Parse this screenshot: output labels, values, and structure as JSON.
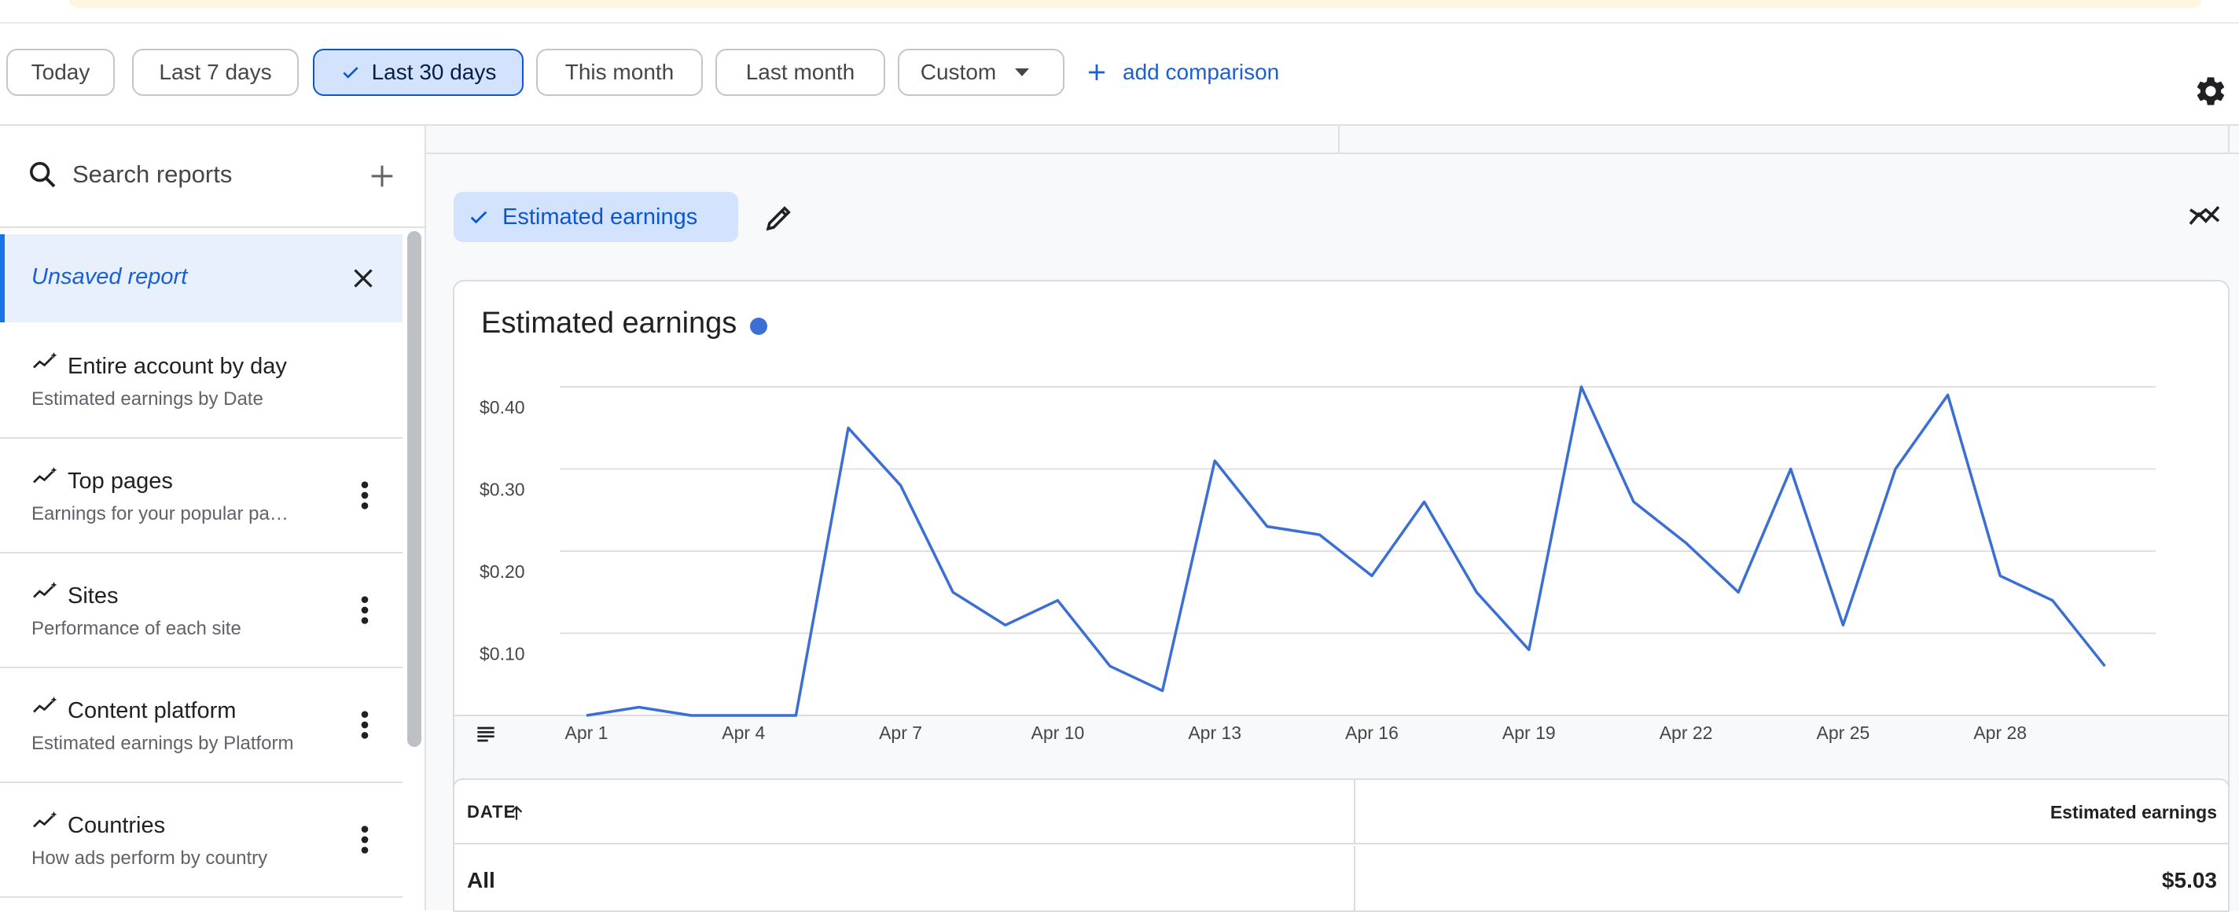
{
  "date_ranges": [
    {
      "label": "Today",
      "selected": false
    },
    {
      "label": "Last 7 days",
      "selected": false
    },
    {
      "label": "Last 30 days",
      "selected": true
    },
    {
      "label": "This month",
      "selected": false
    },
    {
      "label": "Last month",
      "selected": false
    }
  ],
  "custom_label": "Custom",
  "add_comparison_label": "add comparison",
  "search": {
    "label": "Search reports"
  },
  "unsaved_report_label": "Unsaved report",
  "reports": [
    {
      "title": "Entire account by day",
      "subtitle": "Estimated earnings by Date"
    },
    {
      "title": "Top pages",
      "subtitle": "Earnings for your popular pages"
    },
    {
      "title": "Sites",
      "subtitle": "Performance of each site"
    },
    {
      "title": "Content platform",
      "subtitle": "Estimated earnings by Platform"
    },
    {
      "title": "Countries",
      "subtitle": "How ads perform by country"
    }
  ],
  "metric_chip_label": "Estimated earnings",
  "colors": {
    "accent": "#3b6fd4",
    "chip_bg": "#d3e3fd",
    "chip_text": "#0b57d0"
  },
  "chart_data": {
    "type": "line",
    "title": "Estimated earnings",
    "x_tick_labels": [
      "Apr 1",
      "Apr 4",
      "Apr 7",
      "Apr 10",
      "Apr 13",
      "Apr 16",
      "Apr 19",
      "Apr 22",
      "Apr 25",
      "Apr 28"
    ],
    "y_tick_labels": [
      "$0.40",
      "$0.30",
      "$0.20",
      "$0.10"
    ],
    "ylim": [
      0,
      0.4
    ],
    "grid": true,
    "series": [
      {
        "x": [
          "Apr 1",
          "Apr 2",
          "Apr 3",
          "Apr 4",
          "Apr 5",
          "Apr 6",
          "Apr 7",
          "Apr 8",
          "Apr 9",
          "Apr 10",
          "Apr 11",
          "Apr 12",
          "Apr 13",
          "Apr 14",
          "Apr 15",
          "Apr 16",
          "Apr 17",
          "Apr 18",
          "Apr 19",
          "Apr 20",
          "Apr 21",
          "Apr 22",
          "Apr 23",
          "Apr 24",
          "Apr 25",
          "Apr 26",
          "Apr 27",
          "Apr 28",
          "Apr 29",
          "Apr 30"
        ],
        "values": [
          0.0,
          0.01,
          0.0,
          0.0,
          0.0,
          0.35,
          0.28,
          0.15,
          0.11,
          0.14,
          0.06,
          0.03,
          0.31,
          0.23,
          0.22,
          0.17,
          0.26,
          0.15,
          0.08,
          0.4,
          0.26,
          0.21,
          0.15,
          0.3,
          0.11,
          0.3,
          0.39,
          0.17,
          0.14,
          0.06
        ]
      }
    ]
  },
  "table": {
    "col_date": "DATE",
    "col_earnings": "Estimated earnings",
    "total_label": "All",
    "total_value": "$5.03"
  }
}
